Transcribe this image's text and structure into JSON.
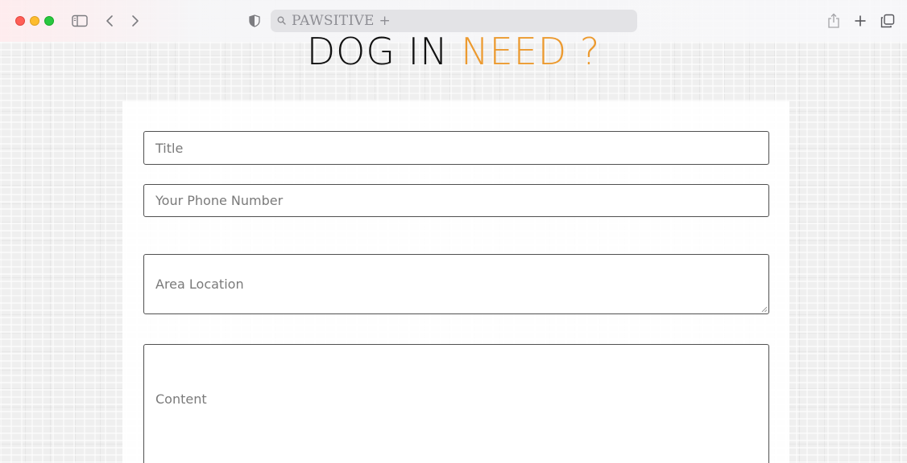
{
  "browser": {
    "address_text": "PAWSITIVE +"
  },
  "heading": {
    "part1": "DOG IN ",
    "part2": "NEED ?",
    "accent_color": "#ec9a2f"
  },
  "form": {
    "title_placeholder": "Title",
    "phone_placeholder": "Your Phone Number",
    "area_placeholder": "Area Location",
    "content_placeholder": "Content"
  }
}
